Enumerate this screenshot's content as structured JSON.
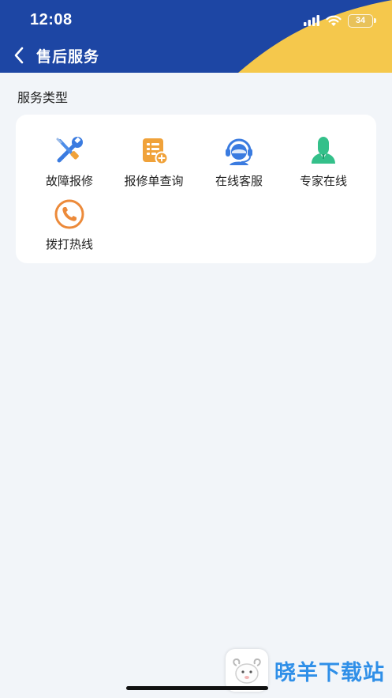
{
  "status_bar": {
    "time": "12:08",
    "battery": "34",
    "icons": [
      "signal-icon",
      "wifi-icon",
      "battery-icon"
    ]
  },
  "nav": {
    "title": "售后服务",
    "back_icon": "chevron-left-icon"
  },
  "section": {
    "title": "服务类型"
  },
  "services": [
    {
      "label": "故障报修",
      "icon": "wrench-screwdriver-icon"
    },
    {
      "label": "报修单查询",
      "icon": "document-search-icon"
    },
    {
      "label": "在线客服",
      "icon": "headset-agent-icon"
    },
    {
      "label": "专家在线",
      "icon": "expert-person-icon"
    },
    {
      "label": "拨打热线",
      "icon": "phone-icon"
    }
  ],
  "watermark": {
    "text": "晓羊下载站"
  },
  "colors": {
    "header_blue": "#1d46a4",
    "header_yellow": "#f5c84c",
    "background": "#f2f5f9",
    "icon_blue": "#3a7be0",
    "icon_orange": "#f0a23a",
    "icon_green": "#34c08a",
    "icon_phone": "#ec8a3a",
    "watermark_blue": "#2f8fe8"
  }
}
